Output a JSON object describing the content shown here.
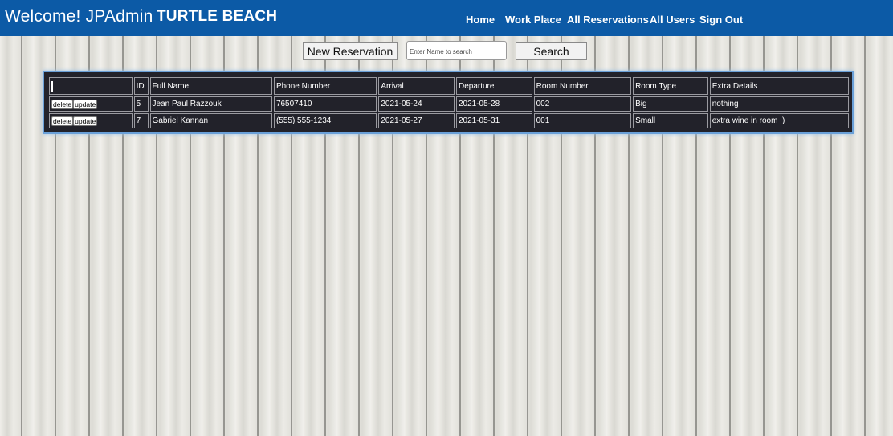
{
  "header": {
    "welcome": "Welcome! JPAdmin",
    "brand": "TURTLE BEACH",
    "nav": [
      "Home",
      "Work Place",
      "All Reservations",
      "All Users",
      "Sign Out"
    ]
  },
  "toolbar": {
    "new_reservation_label": "New Reservation",
    "search_placeholder": "Enter Name to search",
    "search_label": "Search"
  },
  "table": {
    "headers": [
      "",
      "ID",
      "Full Name",
      "Phone Number",
      "Arrival",
      "Departure",
      "Room Number",
      "Room Type",
      "Extra Details"
    ],
    "row_actions": {
      "delete": "delete",
      "update": "update"
    },
    "rows": [
      {
        "id": "5",
        "full_name": "Jean Paul Razzouk",
        "phone": "76507410",
        "arrival": "2021-05-24",
        "departure": "2021-05-28",
        "room_number": "002",
        "room_type": "Big",
        "extra": "nothing"
      },
      {
        "id": "7",
        "full_name": "Gabriel Kannan",
        "phone": "(555) 555-1234",
        "arrival": "2021-05-27",
        "departure": "2021-05-31",
        "room_number": "001",
        "room_type": "Small",
        "extra": "extra wine in room :)"
      }
    ]
  },
  "colors": {
    "header_bg": "#0c5aa6",
    "table_bg": "#22222a",
    "table_border": "#6aa0d8"
  }
}
